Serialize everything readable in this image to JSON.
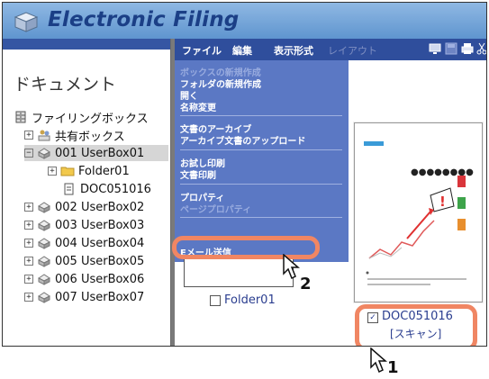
{
  "app": {
    "title": "Electronic Filing"
  },
  "menubar": {
    "items": [
      {
        "label": "ファイル"
      },
      {
        "label": "編集"
      },
      {
        "label": "表示形式"
      },
      {
        "label": "レイアウト"
      }
    ]
  },
  "sidebar": {
    "heading": "ドキュメント",
    "root": "ファイリングボックス",
    "shared": "共有ボックス",
    "items": [
      {
        "label": "001 UserBox01"
      },
      {
        "label": "Folder01"
      },
      {
        "label": "DOC051016"
      },
      {
        "label": "002 UserBox02"
      },
      {
        "label": "003 UserBox03"
      },
      {
        "label": "004 UserBox04"
      },
      {
        "label": "005 UserBox05"
      },
      {
        "label": "006 UserBox06"
      },
      {
        "label": "007 UserBox07"
      }
    ]
  },
  "dropdown": {
    "items": [
      {
        "label": "ボックスの新規作成"
      },
      {
        "label": "フォルダの新規作成"
      },
      {
        "label": "開く"
      },
      {
        "label": "名称変更"
      },
      {
        "label": "文書のアーカイブ"
      },
      {
        "label": "アーカイブ文書のアップロード"
      },
      {
        "label": "お試し印刷"
      },
      {
        "label": "文書印刷"
      },
      {
        "label": "プロパティ"
      },
      {
        "label": "ページプロパティ"
      },
      {
        "label": "Eメール送信"
      }
    ]
  },
  "content": {
    "folder_label": "Folder01",
    "doc_label": "DOC051016",
    "doc_sub": "[スキャン]",
    "thumbnail_dots": "●●●●●●●●"
  },
  "callouts": {
    "one": "1",
    "two": "2"
  },
  "colors": {
    "highlight": "#f08663",
    "toolbar": "#2f4e9c",
    "menu": "#5b78c4"
  }
}
